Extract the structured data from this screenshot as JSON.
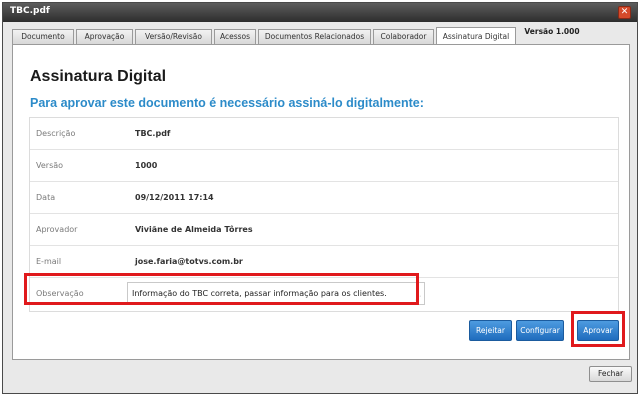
{
  "window": {
    "title": "TBC.pdf",
    "close_symbol": "✕"
  },
  "tabs": [
    {
      "label": "Documento",
      "active": false
    },
    {
      "label": "Aprovação",
      "active": false
    },
    {
      "label": "Versão/Revisão",
      "active": false
    },
    {
      "label": "Acessos",
      "active": false
    },
    {
      "label": "Documentos Relacionados",
      "active": false
    },
    {
      "label": "Colaborador",
      "active": false
    },
    {
      "label": "Assinatura Digital",
      "active": true
    },
    {
      "label": "Versão 1.000",
      "active": false
    }
  ],
  "panel": {
    "heading": "Assinatura Digital",
    "subheading": "Para aprovar este documento é necessário assiná-lo digitalmente:"
  },
  "form": {
    "rows": [
      {
        "label": "Descrição",
        "value": "TBC.pdf"
      },
      {
        "label": "Versão",
        "value": "1000"
      },
      {
        "label": "Data",
        "value": "09/12/2011 17:14"
      },
      {
        "label": "Aprovador",
        "value": "Viviãne de Almeida Tôrres"
      },
      {
        "label": "E-mail",
        "value": "jose.faria@totvs.com.br"
      }
    ],
    "observation": {
      "label": "Observação",
      "value": "Informação do TBC correta, passar informação para os clientes."
    }
  },
  "buttons": {
    "reject": "Rejeitar",
    "configure": "Configurar",
    "approve": "Aprovar",
    "close": "Fechar"
  },
  "colors": {
    "accent": "#2c8bc9",
    "highlight": "#e0191c",
    "button": "#2a78c8"
  }
}
